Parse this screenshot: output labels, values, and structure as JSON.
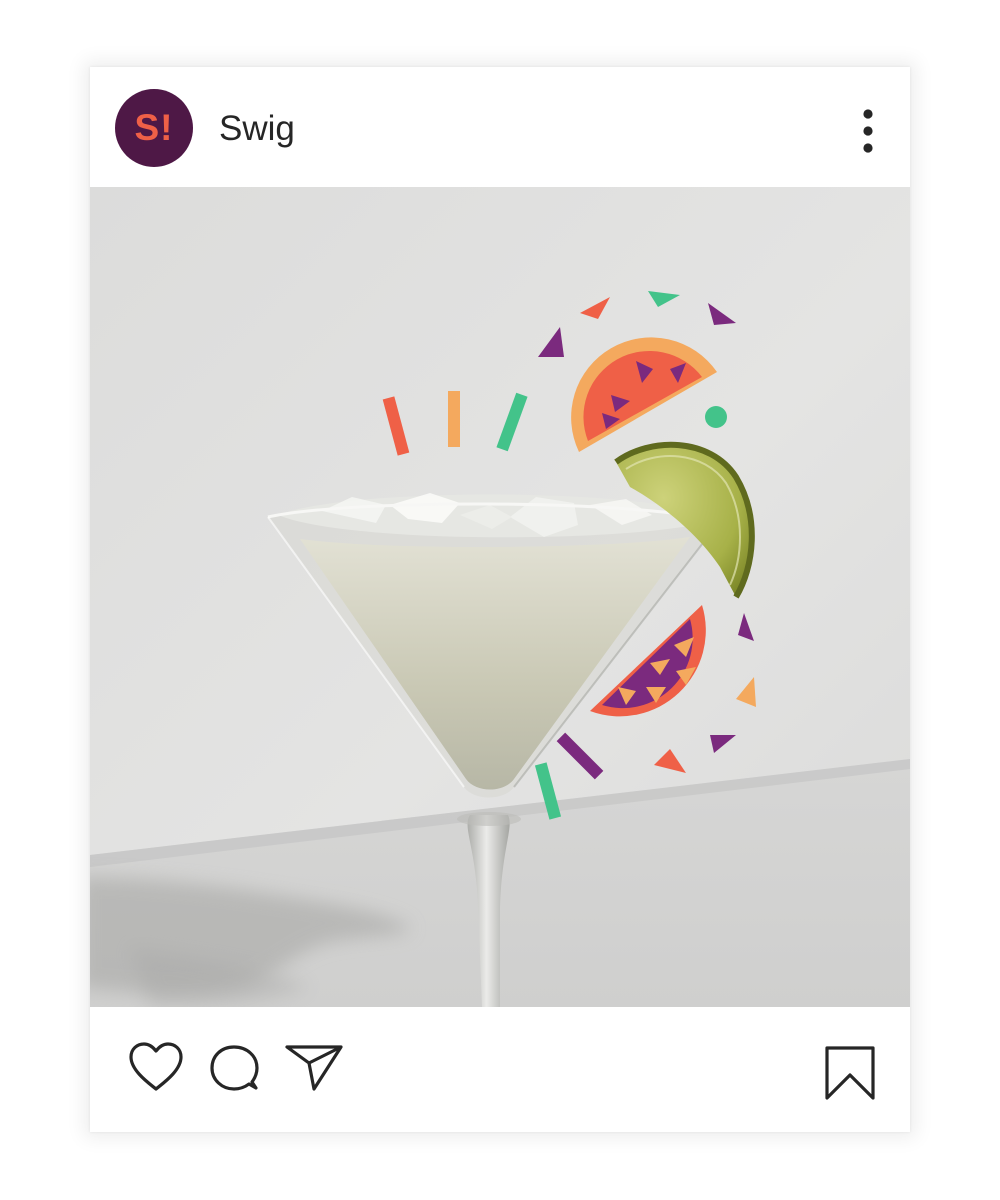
{
  "post": {
    "account": {
      "avatar_text": "S!",
      "name": "Swig"
    },
    "icons": {
      "more": "more-vertical-icon",
      "like": "heart-icon",
      "comment": "comment-icon",
      "share": "paper-plane-icon",
      "save": "bookmark-icon"
    },
    "colors": {
      "brand_purple": "#4e1846",
      "accent_coral": "#ef6047",
      "accent_orange": "#f4a95e",
      "accent_green": "#43c38a",
      "accent_purple": "#7b2a7e"
    }
  }
}
